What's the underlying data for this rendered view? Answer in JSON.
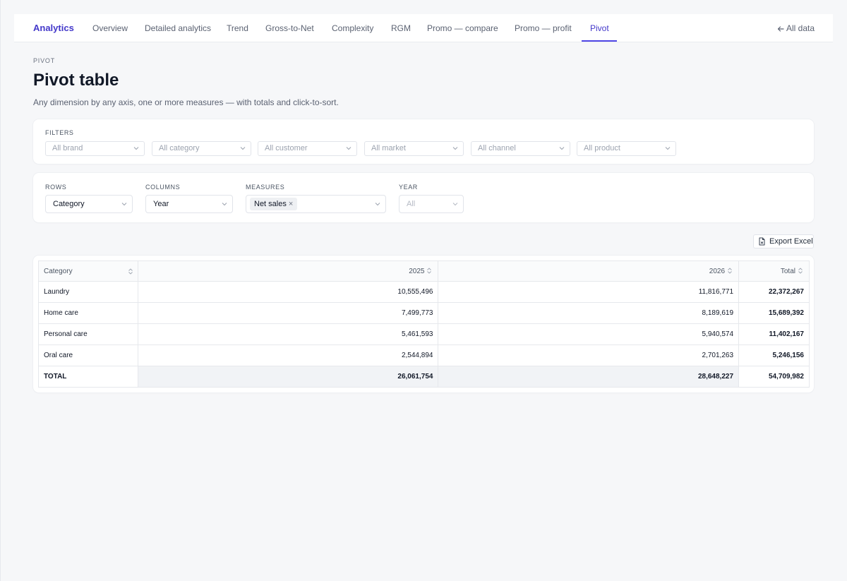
{
  "nav": {
    "brand": "Analytics",
    "tabs": [
      {
        "label": "Overview"
      },
      {
        "label": "Detailed analytics"
      },
      {
        "label": "Trend"
      },
      {
        "label": "Gross-to-Net"
      },
      {
        "label": "Complexity"
      },
      {
        "label": "RGM"
      },
      {
        "label": "Promo — compare"
      },
      {
        "label": "Promo — profit"
      },
      {
        "label": "Pivot",
        "active": true
      }
    ],
    "all_data": "All data",
    "accent_color": "#4f46e5"
  },
  "header": {
    "eyebrow": "PIVOT",
    "title": "Pivot table",
    "subtitle": "Any dimension by any axis, one or more measures — with totals and click-to-sort."
  },
  "filters": {
    "label": "FILTERS",
    "items": [
      {
        "placeholder": "All brand"
      },
      {
        "placeholder": "All category"
      },
      {
        "placeholder": "All customer"
      },
      {
        "placeholder": "All market"
      },
      {
        "placeholder": "All channel"
      },
      {
        "placeholder": "All product"
      }
    ]
  },
  "pivot": {
    "rows_label": "ROWS",
    "rows_value": "Category",
    "columns_label": "COLUMNS",
    "columns_value": "Year",
    "measures_label": "MEASURES",
    "measures_chip": "Net sales",
    "year_label": "YEAR",
    "year_value": "All"
  },
  "export_label": "Export Excel",
  "table": {
    "headers": [
      "Category",
      "2025",
      "2026",
      "Total"
    ],
    "rows": [
      {
        "category": "Laundry",
        "y2025": "10,555,496",
        "y2026": "11,816,771",
        "total": "22,372,267"
      },
      {
        "category": "Home care",
        "y2025": "7,499,773",
        "y2026": "8,189,619",
        "total": "15,689,392"
      },
      {
        "category": "Personal care",
        "y2025": "5,461,593",
        "y2026": "5,940,574",
        "total": "11,402,167"
      },
      {
        "category": "Oral care",
        "y2025": "2,544,894",
        "y2026": "2,701,263",
        "total": "5,246,156"
      }
    ],
    "total_row": {
      "category": "TOTAL",
      "y2025": "26,061,754",
      "y2026": "28,648,227",
      "total": "54,709,982"
    }
  }
}
